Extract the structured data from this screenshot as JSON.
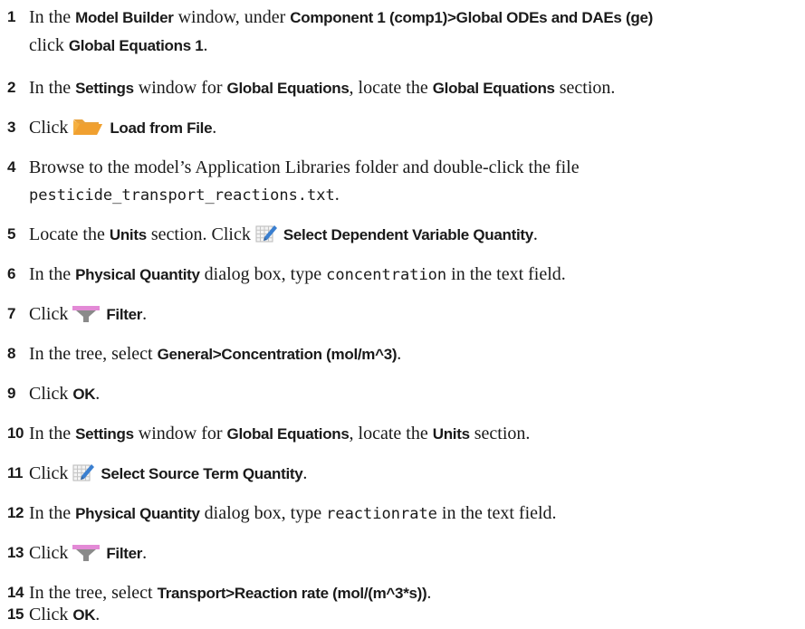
{
  "steps": [
    {
      "num": "1",
      "t1": "In the ",
      "b1": "Model Builder",
      "t2": " window, under ",
      "b2": "Component 1 (comp1)>Global ODEs and DAEs (ge)",
      "t3": "click ",
      "b3": "Global Equations 1",
      "t4": "."
    },
    {
      "num": "2",
      "t1": "In the ",
      "b1": "Settings",
      "t2": " window for ",
      "b2": "Global Equations",
      "t3": ", locate the ",
      "b3": "Global Equations",
      "t4": " section."
    },
    {
      "num": "3",
      "t1": "Click",
      "icon": "open-folder-icon",
      "b1": "Load from File",
      "t2": "."
    },
    {
      "num": "4",
      "t1": "Browse to the model’s Application Libraries folder and double-click the file",
      "code": "pesticide_transport_reactions.txt",
      "t2": "."
    },
    {
      "num": "5",
      "t1": "Locate the ",
      "b1": "Units",
      "t2": " section. Click",
      "icon": "select-quantity-icon",
      "b2": "Select Dependent Variable Quantity",
      "t3": "."
    },
    {
      "num": "6",
      "t1": "In the ",
      "b1": "Physical Quantity",
      "t2": " dialog box, type ",
      "code": "concentration",
      "t3": " in the text field."
    },
    {
      "num": "7",
      "t1": "Click",
      "icon": "filter-icon",
      "b1": "Filter",
      "t2": "."
    },
    {
      "num": "8",
      "t1": "In the tree, select ",
      "b1": "General>Concentration (mol/m^3)",
      "t2": "."
    },
    {
      "num": "9",
      "t1": "Click ",
      "b1": "OK",
      "t2": "."
    },
    {
      "num": "10",
      "t1": "In the ",
      "b1": "Settings",
      "t2": " window for ",
      "b2": "Global Equations",
      "t3": ", locate the ",
      "b3": "Units",
      "t4": " section."
    },
    {
      "num": "11",
      "t1": "Click",
      "icon": "select-quantity-icon",
      "b1": "Select Source Term Quantity",
      "t2": "."
    },
    {
      "num": "12",
      "t1": "In the ",
      "b1": "Physical Quantity",
      "t2": " dialog box, type ",
      "code": "reactionrate",
      "t3": " in the text field."
    },
    {
      "num": "13",
      "t1": "Click",
      "icon": "filter-icon",
      "b1": "Filter",
      "t2": "."
    },
    {
      "num": "14",
      "t1": "In the tree, select ",
      "b1": "Transport>Reaction rate (mol/(m^3*s))",
      "t2": "."
    },
    {
      "num": "15",
      "t1": "Click ",
      "b1": "OK",
      "t2": "."
    }
  ]
}
